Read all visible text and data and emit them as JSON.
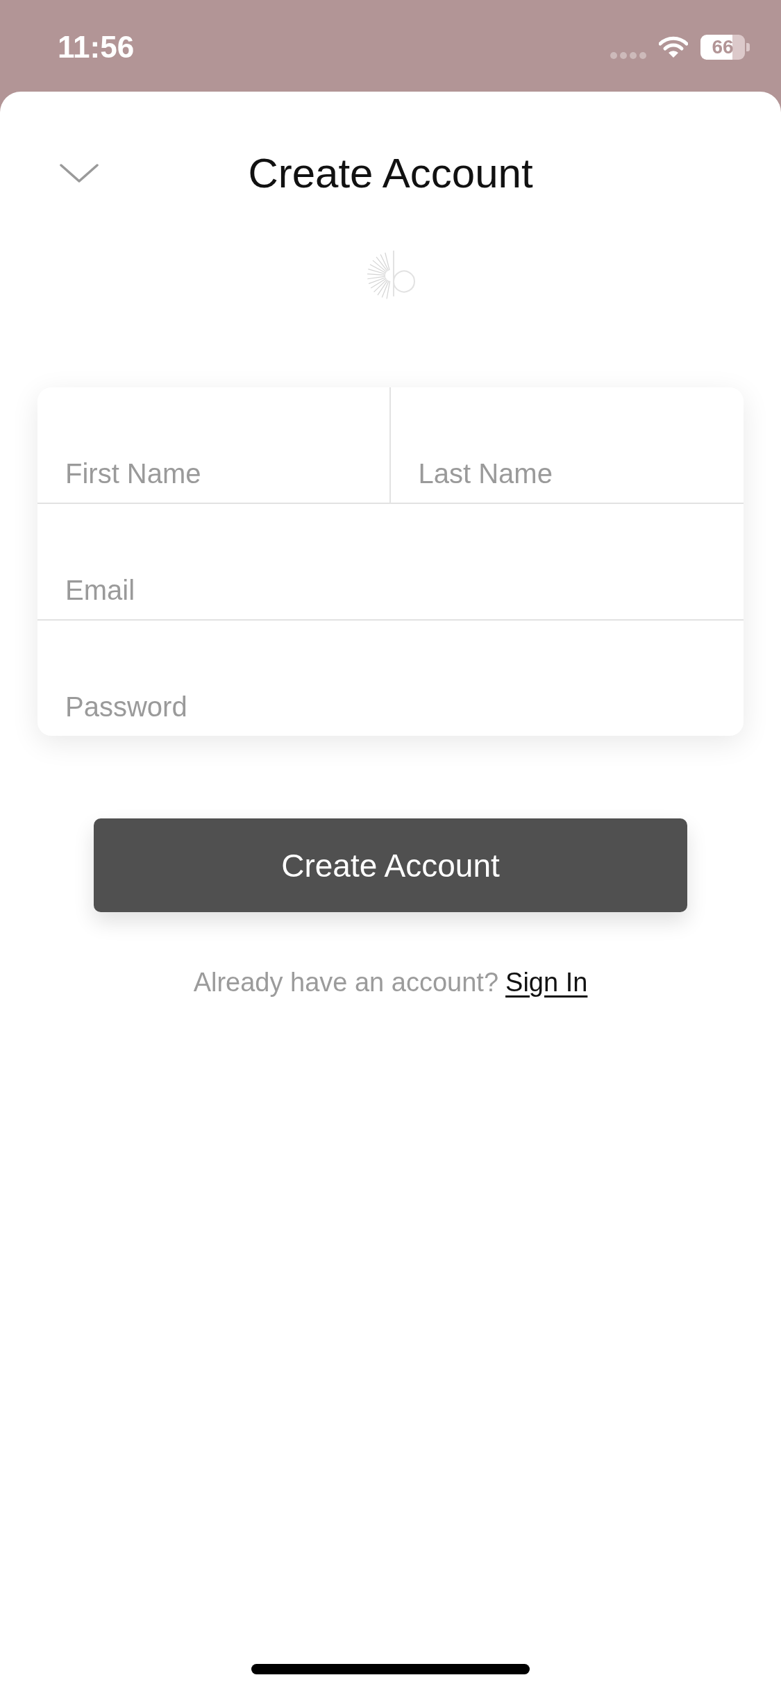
{
  "status_bar": {
    "time": "11:56",
    "battery": "66"
  },
  "header": {
    "title": "Create Account"
  },
  "form": {
    "rows": [
      {
        "fields": [
          {
            "placeholder": "First Name"
          },
          {
            "placeholder": "Last Name"
          }
        ]
      },
      {
        "fields": [
          {
            "placeholder": "Email"
          }
        ]
      },
      {
        "fields": [
          {
            "placeholder": "Password"
          }
        ]
      }
    ]
  },
  "primary_button": {
    "label": "Create Account"
  },
  "sign_in_prompt": {
    "text": "Already have an account?",
    "link": "Sign In"
  }
}
